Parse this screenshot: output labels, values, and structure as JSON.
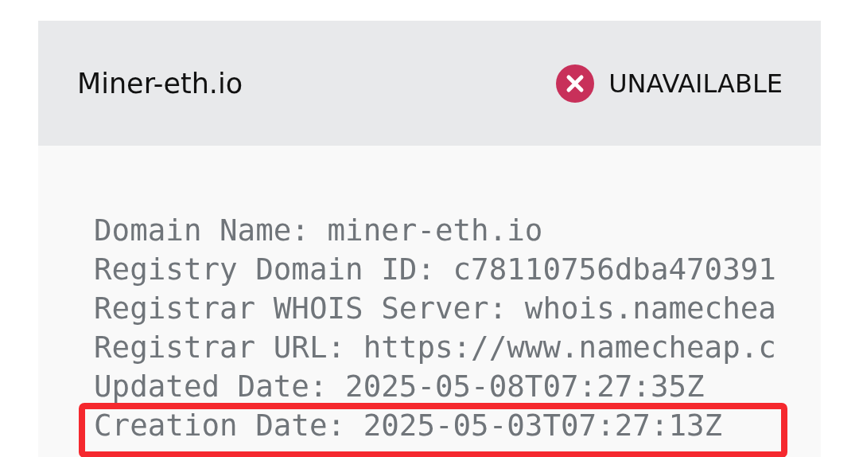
{
  "header": {
    "domain": "Miner-eth.io",
    "status": {
      "label": "UNAVAILABLE",
      "available": false
    }
  },
  "whois_lines": [
    {
      "text": "Domain Name: miner-eth.io",
      "highlighted": false
    },
    {
      "text": "Registry Domain ID: c78110756dba470391",
      "highlighted": false
    },
    {
      "text": "Registrar WHOIS Server: whois.namechea",
      "highlighted": false
    },
    {
      "text": "Registrar URL: https://www.namecheap.c",
      "highlighted": false
    },
    {
      "text": "Updated Date: 2025-05-08T07:27:35Z",
      "highlighted": false
    },
    {
      "text": "Creation Date: 2025-05-03T07:27:13Z",
      "highlighted": true
    }
  ]
}
